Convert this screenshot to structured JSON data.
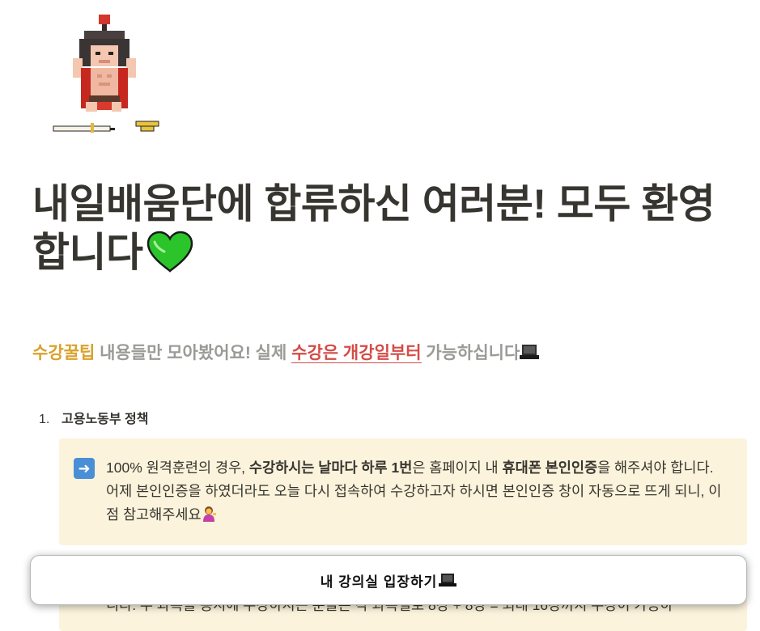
{
  "page_icon": "pixel-spartan-warrior",
  "page_title": "내일배움단에 합류하신 여러분! 모두 환영합니다",
  "title_emoji": "green-heart-icon",
  "subtitle": {
    "part1": "수강꿀팁",
    "part2": " 내용들만 모아봤어요! 실제 ",
    "part3": "수강은 개강일부터",
    "part4": " 가능하십니다",
    "emoji": "laptop-icon"
  },
  "list": [
    {
      "number": "1.",
      "label": "고용노동부 정책"
    }
  ],
  "callout": {
    "icon": "arrow-right-icon",
    "t1": "100% 원격훈련의 경우, ",
    "b1": "수강하시는 날마다 하루 1번",
    "t2": "은 홈페이지 내 ",
    "b2": "휴대폰 본인인증",
    "t3": "을 해주셔야 합니다. 어제 본인인증을 하였더라도 오늘 다시 접속하여 수강하고자 하시면 본인인증 창이 자동으로 뜨게 되니, 이 점 참고해주세요",
    "emoji": "person-tipping-hand-icon"
  },
  "callout2_partial": "니다. 두 과목을 동시에 수강하시는 분들은 각 과목별로 8강 + 8강 = 최대 16강까지 수강이 가능하",
  "enter_button": {
    "label": "내 강의실 입장하기",
    "emoji": "laptop-icon"
  },
  "colors": {
    "orange": "#d9a22b",
    "red": "#d44c47",
    "callout_bg": "#fbf3db",
    "gray_text": "#9b9a97"
  }
}
